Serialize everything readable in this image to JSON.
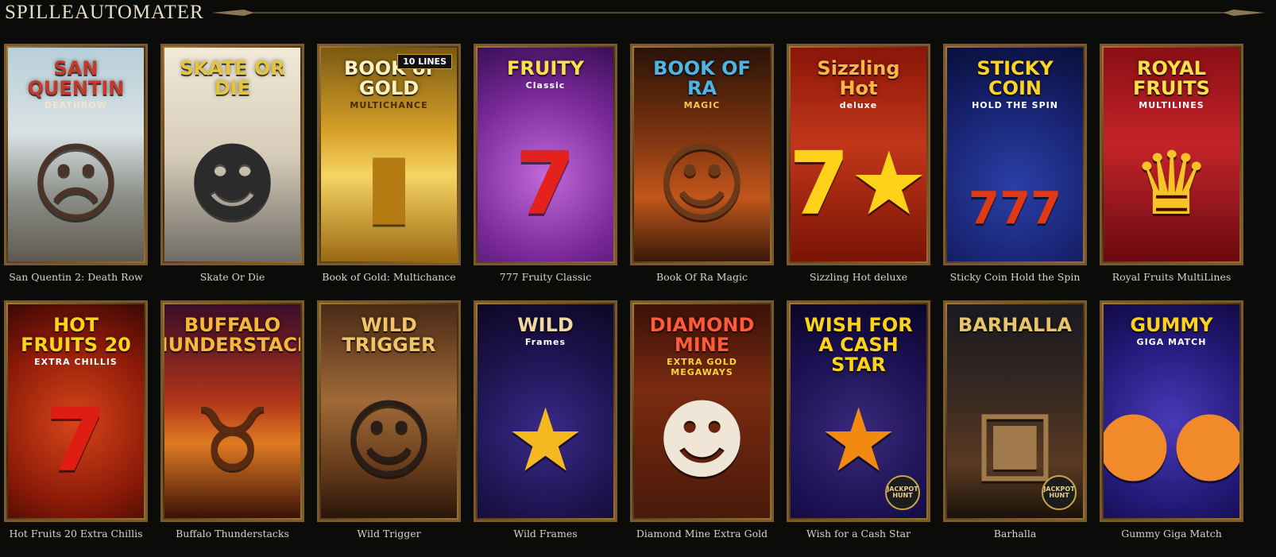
{
  "header": {
    "title": "SPILLEAUTOMATER"
  },
  "games": [
    {
      "name": "San Quentin 2: Death Row",
      "logo": "SAN QUENTIN",
      "sub": "DEATHROW",
      "emblem": "☹",
      "bg": "linear-gradient(180deg,#b8cfd9 0%,#d9e2e4 40%,#8a8e86 70%,#5f5a50 100%)",
      "logo_color": "#c33a2a",
      "sub_color": "#f0e6cf",
      "emblem_color": "#4a3327"
    },
    {
      "name": "Skate Or Die",
      "logo": "SKATE OR DIE",
      "sub": "",
      "emblem": "☻",
      "bg": "linear-gradient(180deg,#f2e9d8 0%,#d6ccb8 50%,#6f6c67 100%)",
      "logo_color": "#e4c53c",
      "sub_color": "#222",
      "emblem_color": "#2b2b2b"
    },
    {
      "name": "Book of Gold: Multichance",
      "logo": "BOOK of GOLD",
      "sub": "MULTICHANCE",
      "emblem": "▮",
      "badge": "10 LINES",
      "bg": "linear-gradient(180deg,#7a5a12 0%,#d8a22a 40%,#f6d463 60%,#9a6a14 100%)",
      "logo_color": "#fff3c4",
      "sub_color": "#4a2a05",
      "emblem_color": "#b47b12"
    },
    {
      "name": "777 Fruity Classic",
      "logo": "FRUITY",
      "sub": "Classic",
      "emblem": "7",
      "bg": "radial-gradient(circle at 50% 60%,#c06ad8 0%,#7b2a9c 55%,#3a0f55 100%)",
      "logo_color": "#ffe04a",
      "sub_color": "#ffffff",
      "emblem_color": "#e3221d"
    },
    {
      "name": "Book Of Ra Magic",
      "logo": "BOOK OF RA",
      "sub": "MAGIC",
      "emblem": "☺",
      "bg": "linear-gradient(180deg,#2a1308 0%,#7a3210 40%,#c2561c 70%,#3a1a08 100%)",
      "logo_color": "#4bb6e6",
      "sub_color": "#f2c94a",
      "emblem_color": "#6b3a1a"
    },
    {
      "name": "Sizzling Hot deluxe",
      "logo": "Sizzling Hot",
      "sub": "deluxe",
      "emblem": "7★",
      "bg": "linear-gradient(180deg,#8a1608 0%,#c2361a 45%,#7a1406 100%)",
      "logo_color": "#ffb347",
      "sub_color": "#ffffff",
      "emblem_color": "#ffd21a"
    },
    {
      "name": "Sticky Coin Hold the Spin",
      "logo": "STICKY COIN",
      "sub": "HOLD THE SPIN",
      "emblem": "777",
      "bg": "radial-gradient(circle at 50% 65%,#2a3fa8 0%,#16206a 60%,#0a0f3a 100%)",
      "logo_color": "#ffd31f",
      "sub_color": "#ffffff",
      "emblem_color": "#e03a14"
    },
    {
      "name": "Royal Fruits MultiLines",
      "logo": "ROYAL FRUITS",
      "sub": "MULTILINES",
      "emblem": "♛",
      "bg": "linear-gradient(180deg,#8a0f14 0%,#c3242a 45%,#6a0a10 100%)",
      "logo_color": "#ffe04a",
      "sub_color": "#ffffff",
      "emblem_color": "#f6c428"
    },
    {
      "name": "Hot Fruits 20 Extra Chillis",
      "logo": "HOT FRUITS 20",
      "sub": "EXTRA CHILLIS",
      "emblem": "7",
      "bg": "radial-gradient(circle at 50% 55%,#d8451a 0%,#8c1a08 60%,#3a0804 100%)",
      "logo_color": "#ffd21a",
      "sub_color": "#ffffff",
      "emblem_color": "#e01d12"
    },
    {
      "name": "Buffalo Thunderstacks",
      "logo": "BUFFALO THUNDERSTACKS",
      "sub": "",
      "emblem": "♉",
      "bg": "linear-gradient(180deg,#3a0d2a 0%,#b0341a 45%,#e07a22 65%,#3a1206 100%)",
      "logo_color": "#f5b83a",
      "sub_color": "#fff",
      "emblem_color": "#5a2a12"
    },
    {
      "name": "Wild Trigger",
      "logo": "WILD TRIGGER",
      "sub": "",
      "emblem": "☺",
      "bg": "linear-gradient(180deg,#4a2a16 0%,#a06a38 45%,#6a3e1c 75%,#2a160a 100%)",
      "logo_color": "#f2c46a",
      "sub_color": "#fff",
      "emblem_color": "#2b1d18"
    },
    {
      "name": "Wild Frames",
      "logo": "WILD",
      "sub": "Frames",
      "emblem": "★",
      "bg": "radial-gradient(circle at 50% 60%,#3a2a8a 0%,#1c124a 60%,#0c0824 100%)",
      "logo_color": "#f0d8a0",
      "sub_color": "#ffffff",
      "emblem_color": "#f4b820"
    },
    {
      "name": "Diamond Mine Extra Gold",
      "logo": "DIAMOND MINE",
      "sub": "EXTRA GOLD MEGAWAYS",
      "emblem": "☻",
      "bg": "linear-gradient(180deg,#3a1208 0%,#7a2a10 40%,#4a1a0a 100%)",
      "logo_color": "#ff5a3a",
      "sub_color": "#ffd23a",
      "emblem_color": "#f0e6d8"
    },
    {
      "name": "Wish for a Cash Star",
      "logo": "WISH FOR A CASH STAR",
      "sub": "",
      "emblem": "★",
      "bg": "radial-gradient(circle at 50% 60%,#3a2a7a 0%,#1a1050 60%,#0a0626 100%)",
      "logo_color": "#ffd21a",
      "sub_color": "#fff",
      "emblem_color": "#f28a12",
      "jp": "JACKPOT HUNT"
    },
    {
      "name": "Barhalla",
      "logo": "BARHALLA",
      "sub": "",
      "emblem": "▣",
      "bg": "linear-gradient(180deg,#1a1a22 0%,#3a2a22 45%,#5a3a22 75%,#1a120a 100%)",
      "logo_color": "#e8c46a",
      "sub_color": "#fff",
      "emblem_color": "#a07a4a",
      "jp": "JACKPOT HUNT"
    },
    {
      "name": "Gummy Giga Match",
      "logo": "GUMMY",
      "sub": "GIGA MATCH",
      "emblem": "●●",
      "bg": "radial-gradient(circle at 50% 55%,#4a3ab8 0%,#241a7a 60%,#120a44 100%)",
      "logo_color": "#ffd21a",
      "sub_color": "#ffffff",
      "emblem_color": "#f08a2a"
    }
  ]
}
